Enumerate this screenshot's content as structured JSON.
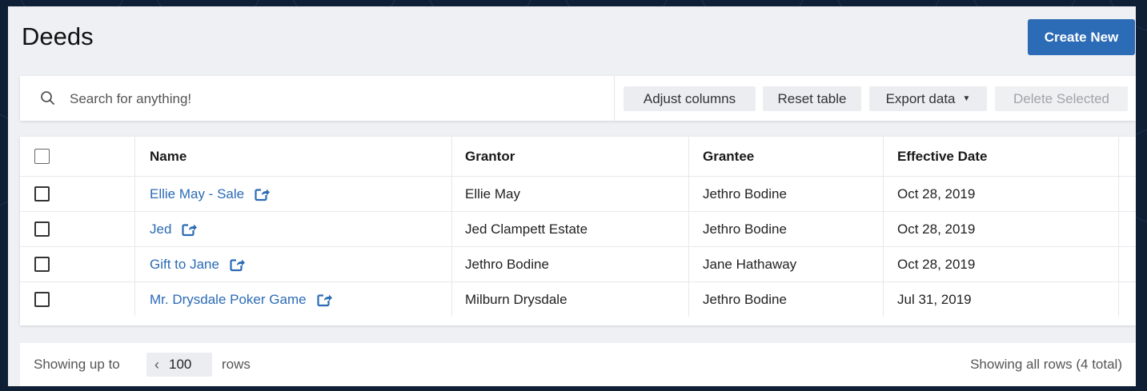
{
  "page": {
    "title": "Deeds",
    "create_label": "Create New"
  },
  "toolbar": {
    "search_placeholder": "Search for anything!",
    "adjust_label": "Adjust columns",
    "reset_label": "Reset table",
    "export_label": "Export data",
    "delete_label": "Delete Selected"
  },
  "table": {
    "columns": [
      "Name",
      "Grantor",
      "Grantee",
      "Effective Date"
    ],
    "rows": [
      {
        "name": "Ellie May - Sale",
        "grantor": "Ellie May",
        "grantee": "Jethro Bodine",
        "date": "Oct 28, 2019"
      },
      {
        "name": "Jed",
        "grantor": "Jed Clampett Estate",
        "grantee": "Jethro Bodine",
        "date": "Oct 28, 2019"
      },
      {
        "name": "Gift to Jane",
        "grantor": "Jethro Bodine",
        "grantee": "Jane Hathaway",
        "date": "Oct 28, 2019"
      },
      {
        "name": "Mr. Drysdale Poker Game",
        "grantor": "Milburn Drysdale",
        "grantee": "Jethro Bodine",
        "date": "Jul 31, 2019"
      }
    ]
  },
  "footer": {
    "showing_prefix": "Showing up to",
    "rows_value": "100",
    "rows_suffix": "rows",
    "summary": "Showing all rows (4 total)"
  },
  "colors": {
    "accent": "#2c6bb5",
    "frame": "#0f2036",
    "panel": "#eef0f4"
  },
  "icons": {
    "search": "search-icon",
    "open": "open-external-icon",
    "export_caret": "caret-down-icon",
    "rows_chevron": "chevron-left-icon"
  }
}
